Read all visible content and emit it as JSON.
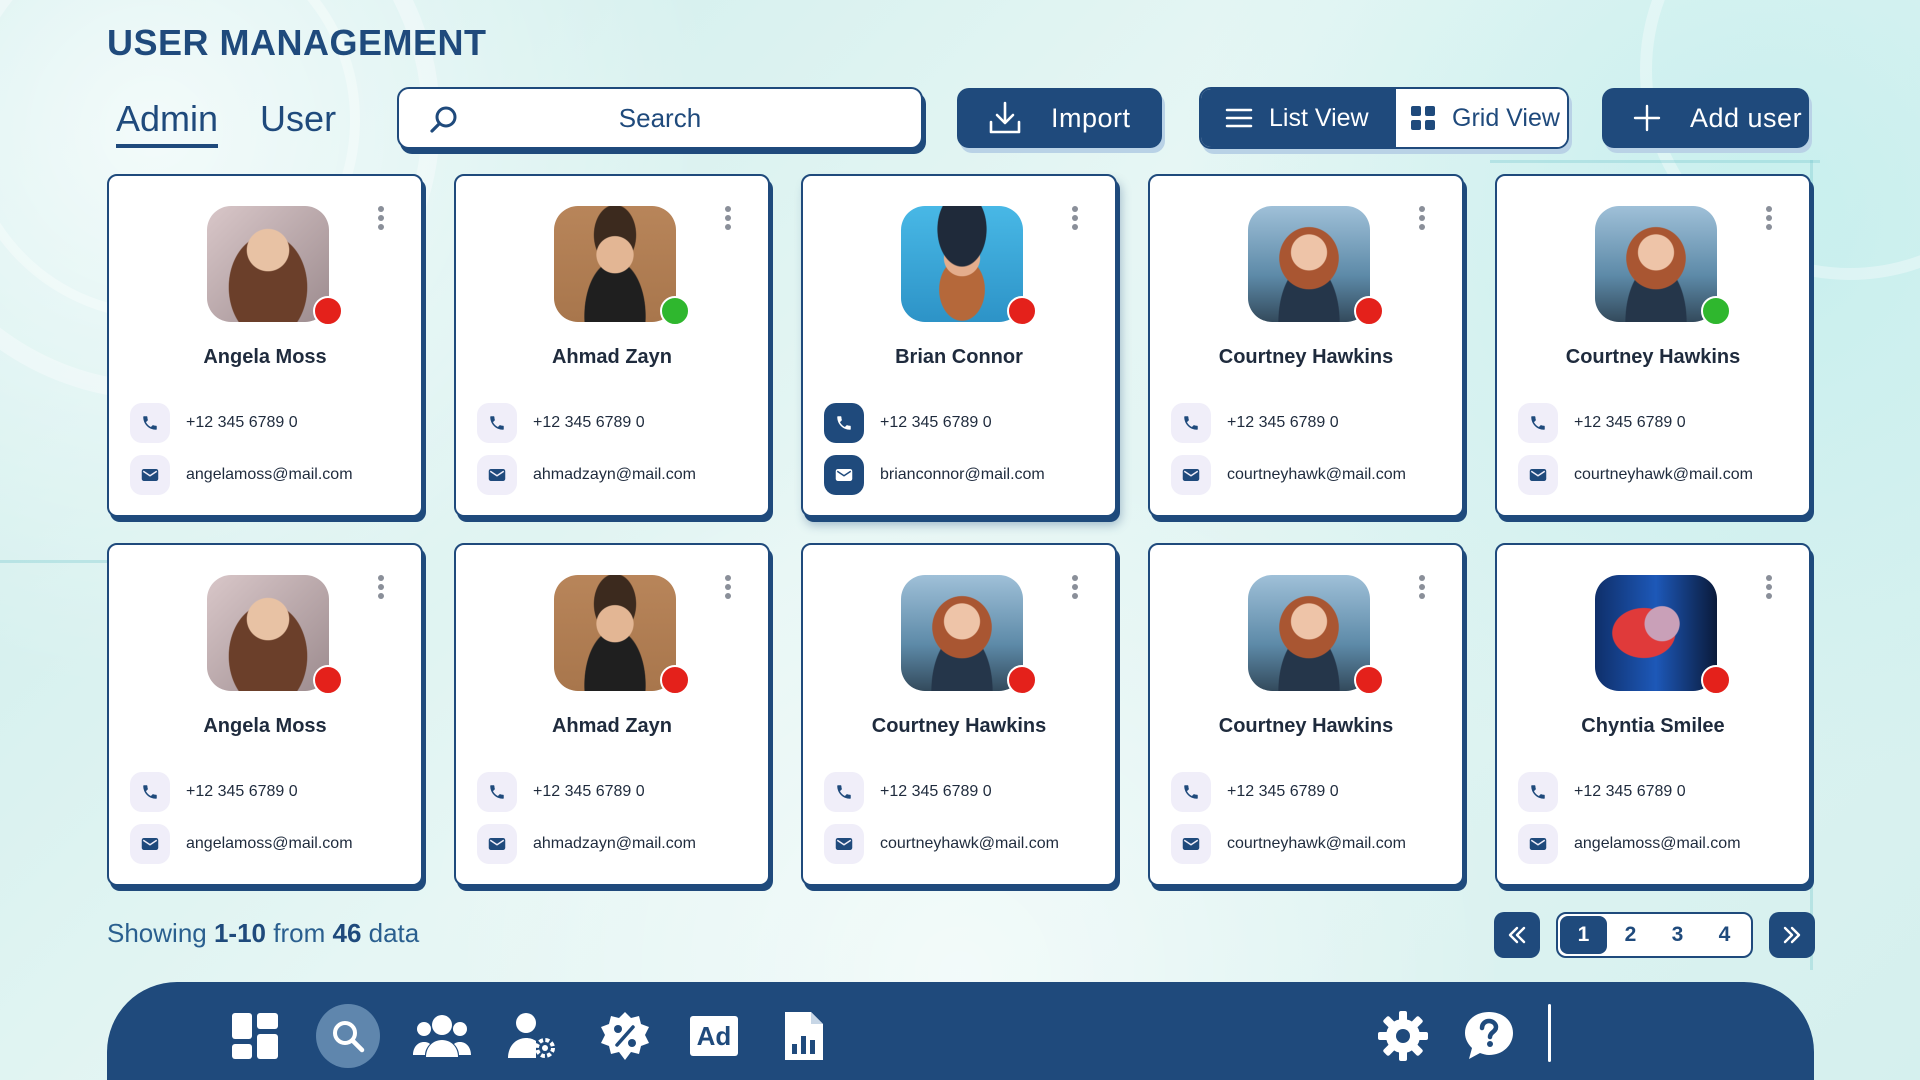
{
  "header": {
    "title": "USER MANAGEMENT",
    "tabs": [
      {
        "label": "Admin",
        "active": true
      },
      {
        "label": "User",
        "active": false
      }
    ]
  },
  "toolbar": {
    "search_placeholder": "Search",
    "import_label": "Import",
    "list_view_label": "List View",
    "grid_view_label": "Grid View",
    "add_user_label": "Add user"
  },
  "colors": {
    "primary": "#1f4a7c",
    "status_online": "#2fb72e",
    "status_offline": "#e4211b"
  },
  "users": [
    {
      "name": "Angela Moss",
      "phone": "+12 345 6789 0",
      "email": "angelamoss@mail.com",
      "status": "offline"
    },
    {
      "name": "Ahmad Zayn",
      "phone": "+12 345 6789 0",
      "email": "ahmadzayn@mail.com",
      "status": "online"
    },
    {
      "name": "Brian Connor",
      "phone": "+12 345 6789 0",
      "email": "brianconnor@mail.com",
      "status": "offline"
    },
    {
      "name": "Courtney Hawkins",
      "phone": "+12 345 6789 0",
      "email": "courtneyhawk@mail.com",
      "status": "offline"
    },
    {
      "name": "Courtney Hawkins",
      "phone": "+12 345 6789 0",
      "email": "courtneyhawk@mail.com",
      "status": "online"
    },
    {
      "name": "Angela Moss",
      "phone": "+12 345 6789 0",
      "email": "angelamoss@mail.com",
      "status": "offline"
    },
    {
      "name": "Ahmad Zayn",
      "phone": "+12 345 6789 0",
      "email": "ahmadzayn@mail.com",
      "status": "offline"
    },
    {
      "name": "Courtney Hawkins",
      "phone": "+12 345 6789 0",
      "email": "courtneyhawk@mail.com",
      "status": "offline"
    },
    {
      "name": "Courtney Hawkins",
      "phone": "+12 345 6789 0",
      "email": "courtneyhawk@mail.com",
      "status": "offline"
    },
    {
      "name": "Chyntia Smilee",
      "phone": "+12 345 6789 0",
      "email": "angelamoss@mail.com",
      "status": "offline"
    }
  ],
  "footer": {
    "showing_prefix": "Showing",
    "showing_range": "1-10",
    "showing_middle": "from",
    "showing_total": "46",
    "showing_suffix": "data"
  },
  "pagination": {
    "first_icon": "double-chevron-left-icon",
    "last_icon": "double-chevron-right-icon",
    "pages": [
      "1",
      "2",
      "3",
      "4"
    ],
    "current": "1"
  },
  "dock": {
    "items": [
      {
        "icon": "dashboard-icon"
      },
      {
        "icon": "search-icon",
        "active": true
      },
      {
        "icon": "users-icon"
      },
      {
        "icon": "user-settings-icon"
      },
      {
        "icon": "discount-icon"
      },
      {
        "icon": "ad-icon",
        "label": "Ad"
      },
      {
        "icon": "report-icon"
      },
      {
        "icon": "settings-gear-icon"
      },
      {
        "icon": "help-icon"
      }
    ]
  }
}
